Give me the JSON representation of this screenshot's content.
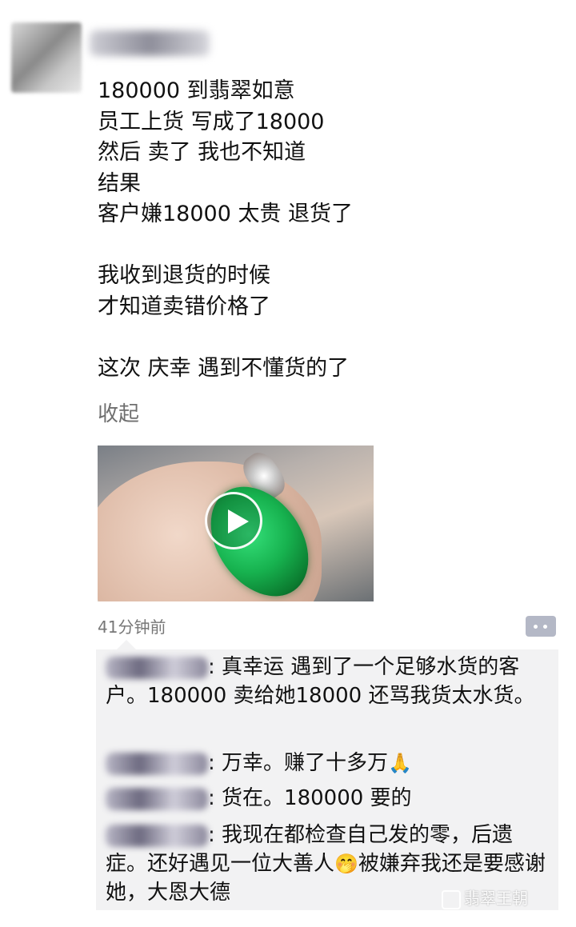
{
  "post": {
    "text": "180000 到翡翠如意\n员工上货 写成了18000\n然后 卖了 我也不知道\n结果\n客户嫌18000 太贵 退货了\n\n我收到退货的时候\n才知道卖错价格了\n\n这次 庆幸 遇到不懂货的了",
    "collapse_label": "收起",
    "timestamp": "41分钟前"
  },
  "comments": [
    {
      "sep": ":",
      "text": " 真幸运 遇到了一个足够水货的客户。180000 卖给她18000 还骂我货太水货。"
    },
    {
      "sep": ":",
      "text": " 万幸。赚了十多万",
      "emoji": "🙏"
    },
    {
      "sep": ":",
      "text": " 货在。180000 要的"
    },
    {
      "sep": ":",
      "text_before": " 我现在都检查自己发的零，后遗症。还好遇见一位大善人",
      "emoji": "🤭",
      "text_after": "被嫌弃我还是要感谢她，大恩大德"
    }
  ],
  "watermark": "翡翠王朝"
}
